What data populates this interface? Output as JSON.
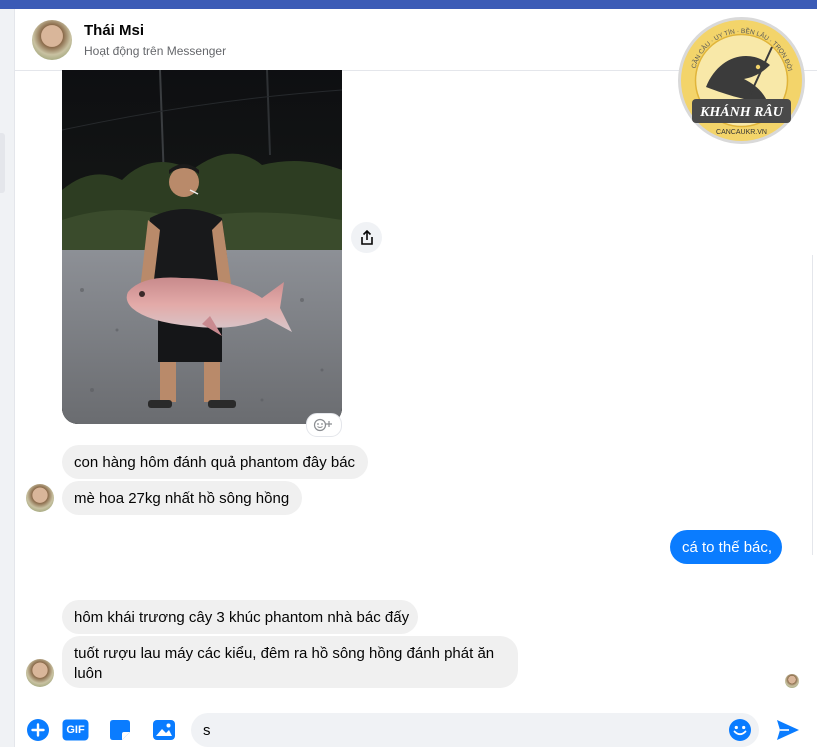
{
  "header": {
    "name": "Thái Msi",
    "status": "Hoạt động trên Messenger"
  },
  "logo": {
    "ring_text": "CẦN CÂU · UY TÍN · BỀN LÂU · TRỌN ĐỜI",
    "brand": "KHÁNH RÂU",
    "site": "CANCAUKR.VN"
  },
  "messages": {
    "m1": "con hàng hôm đánh quả phantom đây bác",
    "m2": "mè hoa 27kg nhất hồ sông hồng",
    "m3": "cá to thế bác,",
    "m4": "hôm khái trương cây 3 khúc phantom nhà bác đấy",
    "m5": "tuốt rượu lau máy các kiểu, đêm ra hồ sông hồng đánh phát ăn luôn"
  },
  "composer": {
    "value": "s",
    "gif_label": "GIF"
  },
  "colors": {
    "accent": "#0a7cff",
    "incoming_bubble": "#f0f0f0",
    "top_bar": "#3b5bb6"
  }
}
